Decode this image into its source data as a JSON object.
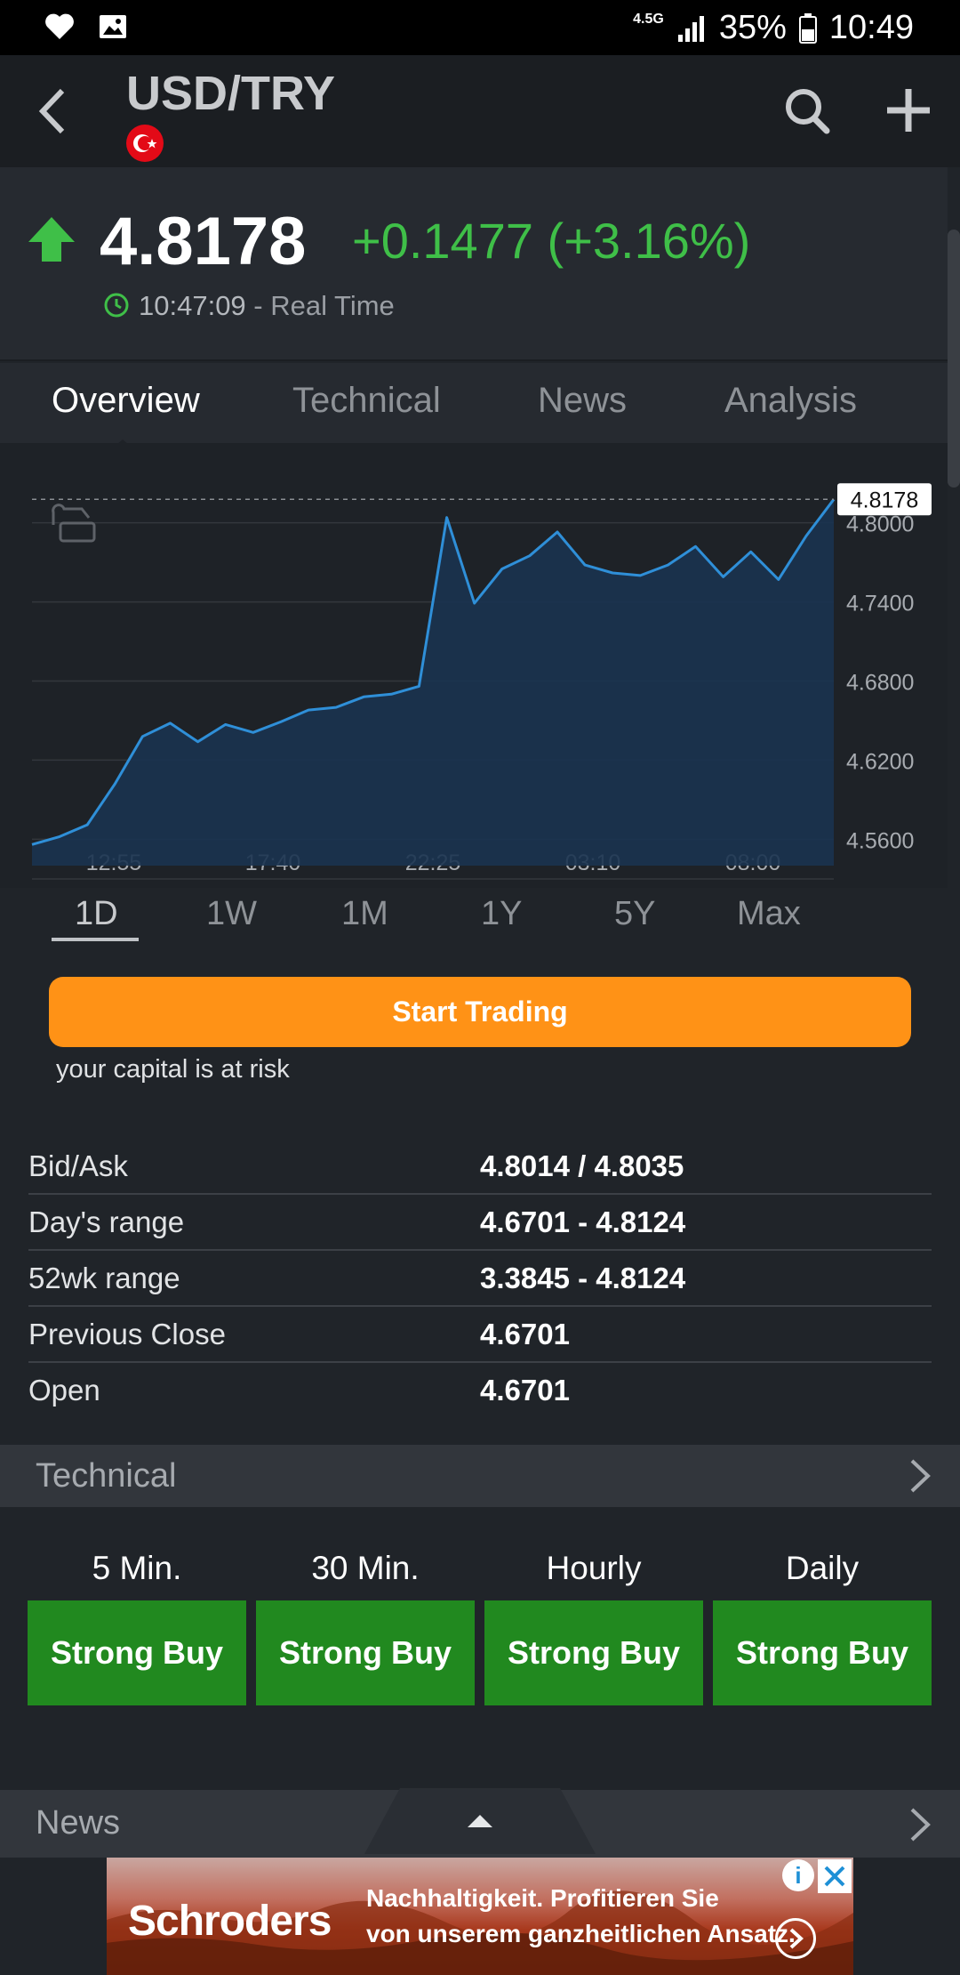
{
  "status_bar": {
    "network": "4.5G",
    "battery": "35%",
    "time": "10:49"
  },
  "header": {
    "title": "USD/TRY",
    "flag": "turkey-flag-icon"
  },
  "quote": {
    "price": "4.8178",
    "change": "+0.1477 (+3.16%)",
    "time": "10:47:09",
    "time_suffix": " - Real Time",
    "direction_color": "#3fbf48"
  },
  "tabs": [
    {
      "label": "Overview",
      "active": true
    },
    {
      "label": "Technical",
      "active": false
    },
    {
      "label": "News",
      "active": false
    },
    {
      "label": "Analysis",
      "active": false
    }
  ],
  "chart_data": {
    "type": "area",
    "x": [
      "12:55",
      "13:40",
      "14:25",
      "15:10",
      "15:55",
      "16:40",
      "17:25",
      "18:10",
      "18:55",
      "19:40",
      "20:25",
      "21:10",
      "21:55",
      "22:40",
      "23:25",
      "00:10",
      "00:55",
      "01:40",
      "02:25",
      "03:10",
      "03:55",
      "04:40",
      "05:25",
      "06:10",
      "06:55",
      "07:40",
      "08:25",
      "09:10",
      "09:55",
      "10:47"
    ],
    "values": [
      4.556,
      4.562,
      4.571,
      4.602,
      4.638,
      4.648,
      4.634,
      4.647,
      4.641,
      4.649,
      4.658,
      4.66,
      4.668,
      4.67,
      4.676,
      4.804,
      4.739,
      4.765,
      4.775,
      4.793,
      4.768,
      4.762,
      4.76,
      4.768,
      4.782,
      4.759,
      4.778,
      4.757,
      4.79,
      4.8178
    ],
    "x_tick_labels": [
      "12:55",
      "17:40",
      "22:25",
      "03:10",
      "08:00"
    ],
    "y_tick_labels": [
      "4.5600",
      "4.6200",
      "4.6800",
      "4.7400",
      "4.8000"
    ],
    "y_ticks": [
      4.56,
      4.62,
      4.68,
      4.74,
      4.8
    ],
    "ylim": [
      4.54,
      4.82
    ],
    "current_value_label": "4.8178",
    "line_color": "#2f8fd8",
    "fill_color": "#1a3350",
    "grid": true
  },
  "periods": [
    {
      "label": "1D",
      "active": true
    },
    {
      "label": "1W",
      "active": false
    },
    {
      "label": "1M",
      "active": false
    },
    {
      "label": "1Y",
      "active": false
    },
    {
      "label": "5Y",
      "active": false
    },
    {
      "label": "Max",
      "active": false
    }
  ],
  "trading": {
    "button_label": "Start Trading",
    "risk_text": "your capital is at risk",
    "button_color": "#ff9216"
  },
  "quote_table": [
    {
      "label": "Bid/Ask",
      "value": "4.8014 / 4.8035"
    },
    {
      "label": "Day's range",
      "value": "4.6701 - 4.8124"
    },
    {
      "label": "52wk range",
      "value": "3.3845 - 4.8124"
    },
    {
      "label": "Previous Close",
      "value": "4.6701"
    },
    {
      "label": "Open",
      "value": "4.6701"
    }
  ],
  "technical_section": {
    "title": "Technical",
    "timeframes": [
      {
        "label": "5 Min.",
        "signal": "Strong Buy"
      },
      {
        "label": "30 Min.",
        "signal": "Strong Buy"
      },
      {
        "label": "Hourly",
        "signal": "Strong Buy"
      },
      {
        "label": "Daily",
        "signal": "Strong Buy"
      }
    ],
    "signal_color": "#21891f"
  },
  "news_section": {
    "title": "News"
  },
  "ad": {
    "brand": "Schroders",
    "line1": "Nachhaltigkeit. Profitieren Sie",
    "line2": "von unserem ganzheitlichen Ansatz.",
    "info_label": "i"
  }
}
